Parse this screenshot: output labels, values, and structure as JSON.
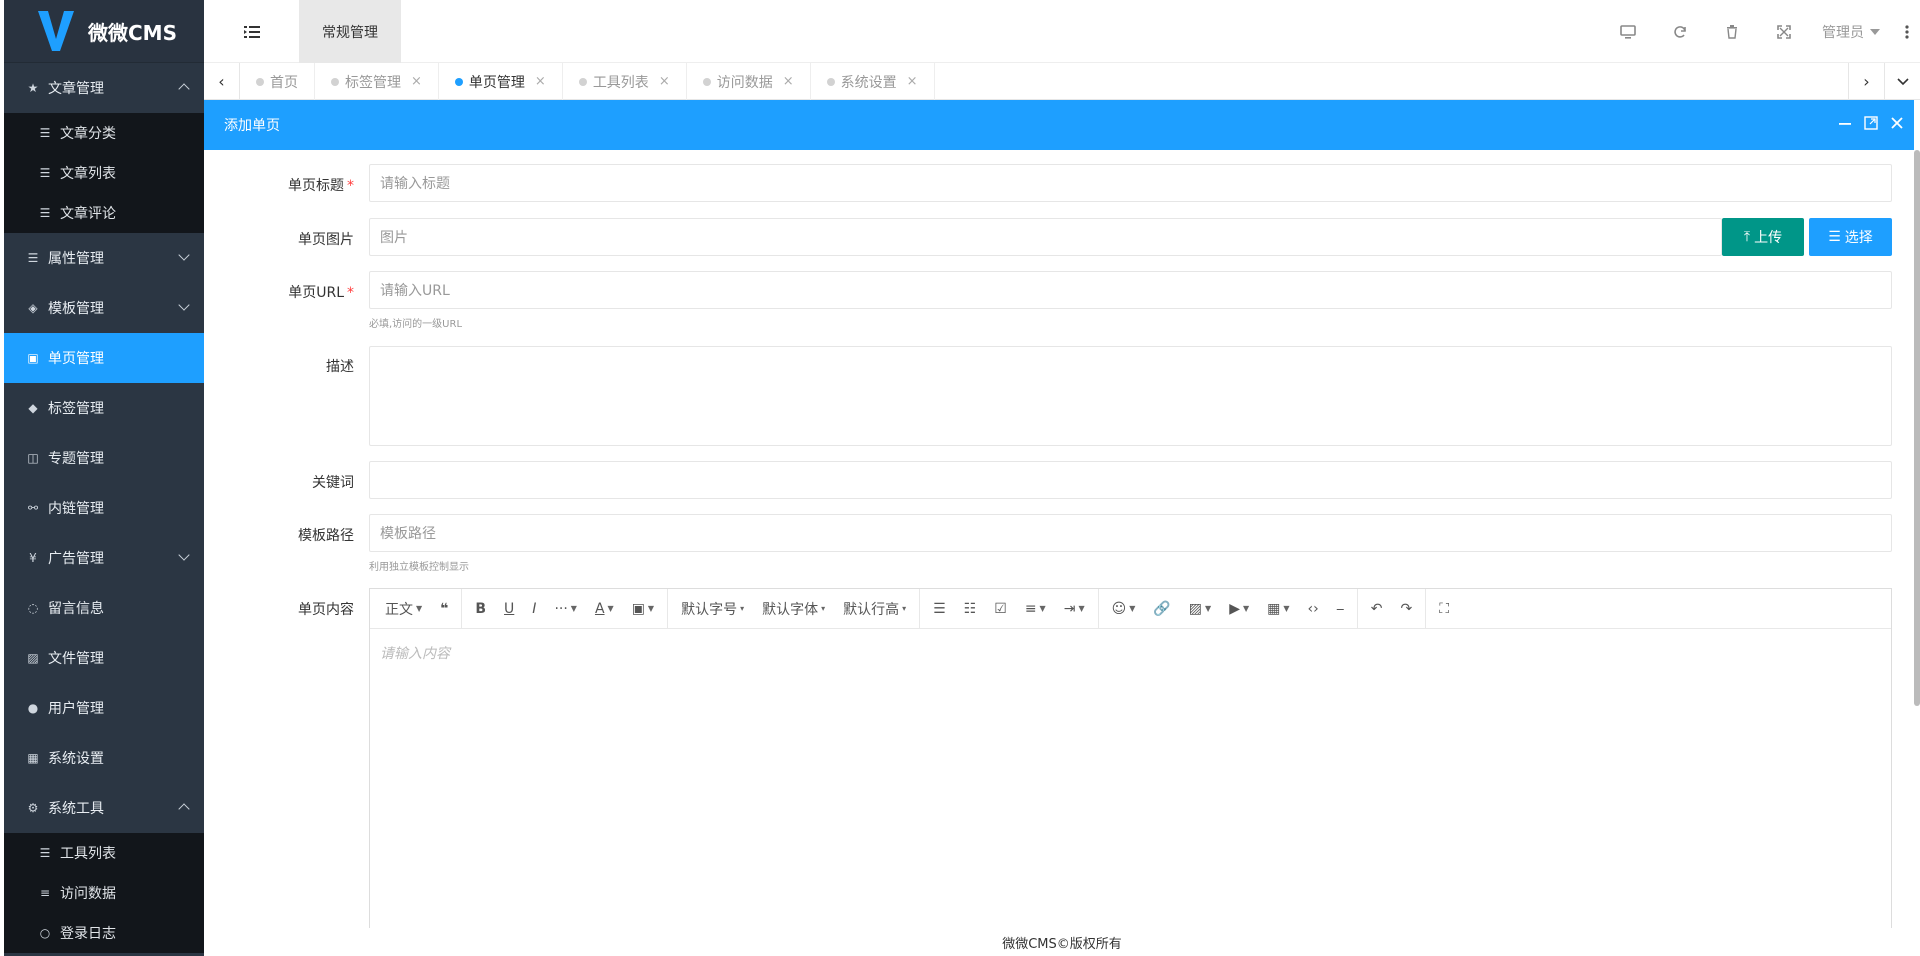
{
  "app": {
    "brand": "微微CMS"
  },
  "sidebar": {
    "items": [
      {
        "label": "文章管理",
        "icon": "star-icon",
        "expanded": true,
        "children": [
          {
            "label": "文章分类"
          },
          {
            "label": "文章列表"
          },
          {
            "label": "文章评论"
          }
        ]
      },
      {
        "label": "属性管理",
        "icon": "list-icon",
        "collapsed": true
      },
      {
        "label": "模板管理",
        "icon": "cube-icon",
        "collapsed": true
      },
      {
        "label": "单页管理",
        "icon": "file-icon",
        "active": true
      },
      {
        "label": "标签管理",
        "icon": "tag-icon"
      },
      {
        "label": "专题管理",
        "icon": "columns-icon"
      },
      {
        "label": "内链管理",
        "icon": "link-icon"
      },
      {
        "label": "广告管理",
        "icon": "yen-icon",
        "collapsed": true
      },
      {
        "label": "留言信息",
        "icon": "comment-icon"
      },
      {
        "label": "文件管理",
        "icon": "image-icon"
      },
      {
        "label": "用户管理",
        "icon": "user-icon"
      },
      {
        "label": "系统设置",
        "icon": "windows-icon"
      },
      {
        "label": "系统工具",
        "icon": "gears-icon",
        "expanded": true,
        "children": [
          {
            "label": "工具列表"
          },
          {
            "label": "访问数据"
          },
          {
            "label": "登录日志"
          }
        ]
      }
    ]
  },
  "header": {
    "top_tab": "常规管理",
    "user": "管理员"
  },
  "tabs": [
    {
      "label": "首页"
    },
    {
      "label": "标签管理",
      "close": "×"
    },
    {
      "label": "单页管理",
      "close": "×",
      "active": true
    },
    {
      "label": "工具列表",
      "close": "×"
    },
    {
      "label": "访问数据",
      "close": "×"
    },
    {
      "label": "系统设置",
      "close": "×"
    }
  ],
  "dialog": {
    "title": "添加单页"
  },
  "form": {
    "title_label": "单页标题",
    "title_placeholder": "请输入标题",
    "image_label": "单页图片",
    "image_placeholder": "图片",
    "upload_button": "上传",
    "select_button": "选择",
    "url_label": "单页URL",
    "url_placeholder": "请输入URL",
    "url_hint": "必填,访问的一级URL",
    "desc_label": "描述",
    "keywords_label": "关键词",
    "template_label": "模板路径",
    "template_placeholder": "模板路径",
    "template_hint": "利用独立模板控制显示",
    "content_label": "单页内容",
    "required_mark": "*"
  },
  "editor": {
    "paragraph": "正文",
    "font_size": "默认字号",
    "font_family": "默认字体",
    "line_height": "默认行高",
    "placeholder": "请输入内容"
  },
  "footer": {
    "copyright": "微微CMS©版权所有"
  },
  "colors": {
    "primary": "#1e9fff",
    "green": "#009688",
    "sidebar": "#2b3643"
  }
}
